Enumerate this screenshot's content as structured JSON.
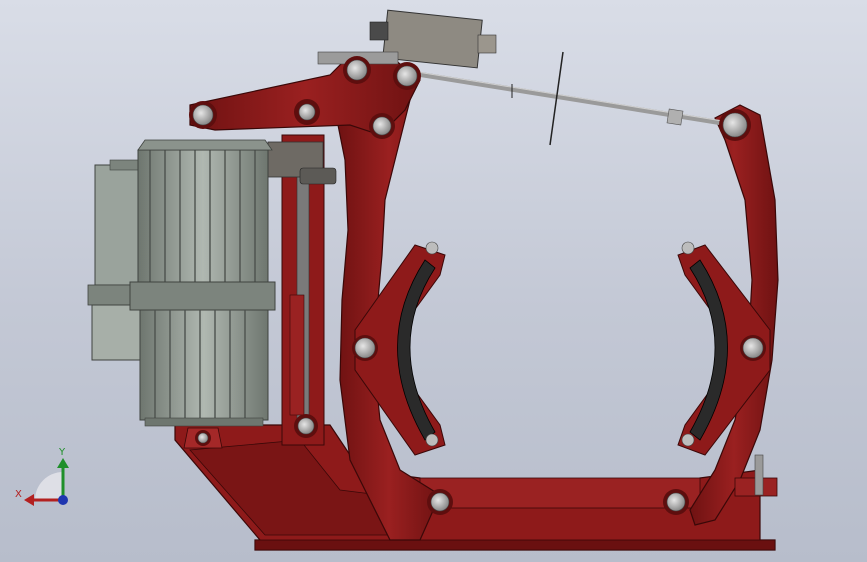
{
  "viewport": {
    "background_top": "#d9dde7",
    "background_bottom": "#b7bdcb"
  },
  "colors": {
    "frame_red": "#8e1a1a",
    "frame_red_dark": "#5e0e0e",
    "frame_red_light": "#b33a3a",
    "thruster_gray": "#8d968f",
    "thruster_dark": "#4d524e",
    "lining_black": "#2a2a2a",
    "pin_gray": "#b9b9b9",
    "rod_gray": "#9a9a9a"
  },
  "triad": {
    "x_label": "X",
    "y_label": "Y",
    "x_color": "#b32020",
    "y_color": "#1f8f2a",
    "origin_color": "#1f36b0"
  },
  "components": {
    "thruster": "electro-hydraulic-thruster",
    "limit_switch": "limit-switch",
    "pull_rod": "pull-rod",
    "left_brake_arm": "left-brake-arm",
    "right_brake_arm": "right-brake-arm",
    "left_brake_shoe": "left-brake-shoe",
    "right_brake_shoe": "right-brake-shoe",
    "base_frame": "base-frame",
    "top_lever": "top-lever"
  }
}
